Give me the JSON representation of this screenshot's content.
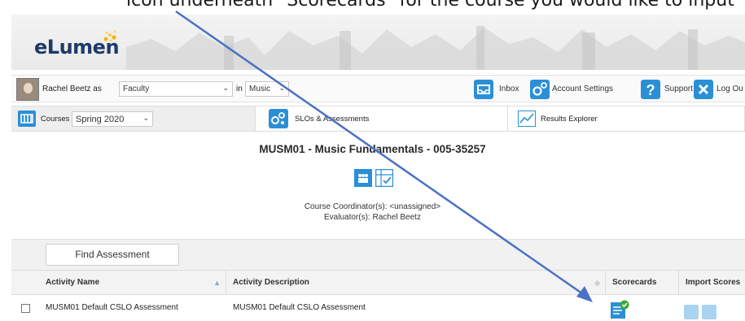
{
  "caption": "icon underneath \"Scorecards\" for the course you would like to input",
  "app": {
    "logo_text": "eLumen"
  },
  "userbar": {
    "user_name": "Rachel Beetz as",
    "role_value": "Faculty",
    "in_label": "in",
    "dept_value": "Music",
    "inbox_label": "Inbox",
    "account_settings_label": "Account Settings",
    "support_label": "Support",
    "logout_label": "Log Ou"
  },
  "nav": {
    "courses_label": "Courses",
    "term_value": "Spring 2020",
    "slos_label": "SLOs & Assessments",
    "results_label": "Results Explorer"
  },
  "course": {
    "title": "MUSM01 - Music Fundamentals - 005-35257",
    "coordinator": "Course Coordinator(s): <unassigned>",
    "evaluator": "Evaluator(s): Rachel Beetz"
  },
  "find_button_label": "Find Assessment",
  "table": {
    "columns": [
      "Activity Name",
      "Activity Description",
      "Scorecards",
      "Import Scores"
    ],
    "rows": [
      {
        "name": "MUSM01 Default CSLO Assessment",
        "description": "MUSM01 Default CSLO Assessment"
      }
    ]
  },
  "colors": {
    "brand_blue": "#2b8fd6",
    "arrow": "#4a72c4",
    "scorecard_green": "#3aaa3a"
  }
}
